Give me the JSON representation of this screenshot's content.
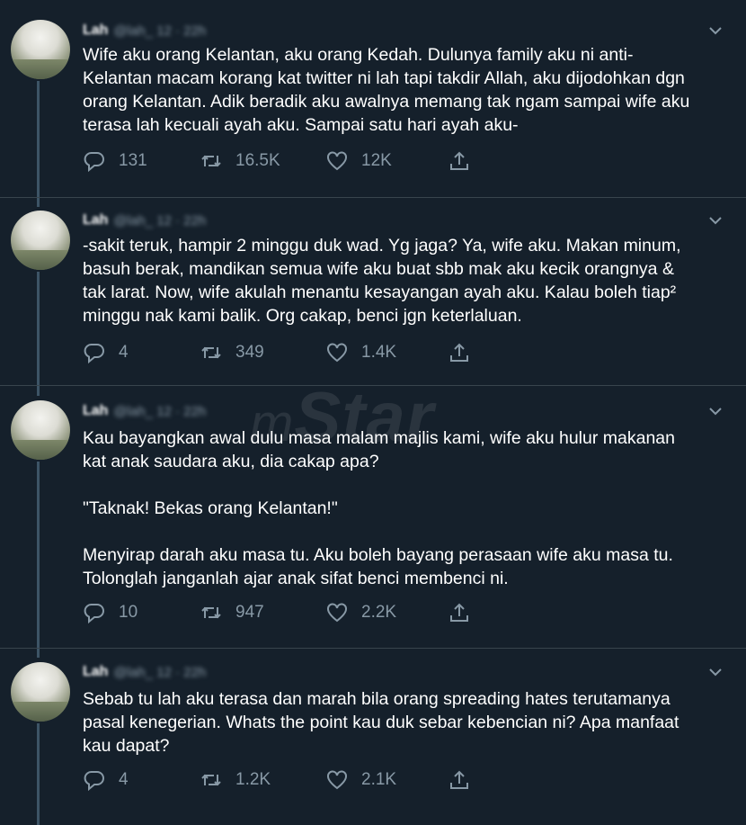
{
  "watermark": {
    "prefix": "m",
    "word": "Star"
  },
  "tweets": [
    {
      "name": "Lah",
      "meta": "@lah_ 12 · 22h",
      "text": "Wife aku orang Kelantan, aku orang Kedah. Dulunya family aku ni anti-\nKelantan macam korang kat twitter ni lah tapi takdir Allah, aku dijodohkan dgn\norang Kelantan. Adik beradik aku awalnya memang tak ngam sampai wife aku\nterasa lah kecuali ayah aku. Sampai satu hari ayah aku-",
      "replies": "131",
      "retweets": "16.5K",
      "likes": "12K"
    },
    {
      "name": "Lah",
      "meta": "@lah_ 12 · 22h",
      "text": "-sakit teruk, hampir 2 minggu duk wad. Yg jaga? Ya, wife aku. Makan minum,\nbasuh berak, mandikan semua wife aku buat sbb mak aku kecik orangnya &\ntak larat. Now, wife akulah menantu kesayangan ayah aku. Kalau boleh tiap²\nminggu nak kami balik. Org cakap, benci jgn keterlaluan.",
      "replies": "4",
      "retweets": "349",
      "likes": "1.4K"
    },
    {
      "name": "Lah",
      "meta": "@lah_ 12 · 22h",
      "text": "Kau bayangkan awal dulu masa malam majlis kami, wife aku hulur makanan\nkat anak saudara aku, dia cakap apa?\n\n\"Taknak! Bekas orang Kelantan!\"\n\nMenyirap darah aku masa tu. Aku boleh bayang perasaan wife aku masa tu.\nTolonglah janganlah ajar anak sifat benci membenci ni.",
      "replies": "10",
      "retweets": "947",
      "likes": "2.2K"
    },
    {
      "name": "Lah",
      "meta": "@lah_ 12 · 22h",
      "text": "Sebab tu lah aku terasa dan marah bila orang spreading hates terutamanya\npasal kenegerian. Whats the point kau duk sebar kebencian ni? Apa manfaat\nkau dapat?",
      "replies": "4",
      "retweets": "1.2K",
      "likes": "2.1K"
    }
  ],
  "icons": {
    "reply": "reply-icon",
    "retweet": "retweet-icon",
    "like": "heart-icon",
    "share": "share-icon",
    "more": "chevron-down-icon"
  },
  "colors": {
    "background": "#15202b",
    "secondary_text": "#8899a6",
    "divider": "#38444d",
    "thread_line": "#3d5466"
  }
}
